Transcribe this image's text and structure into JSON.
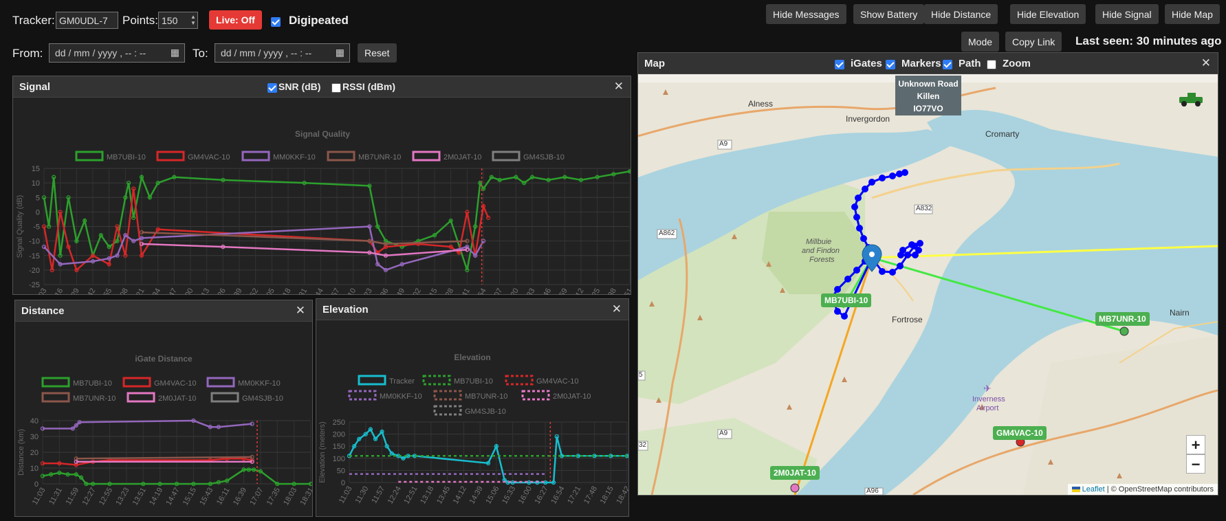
{
  "toolbar": {
    "tracker_label": "Tracker:",
    "tracker_value": "GM0UDL-7",
    "points_label": "Points:",
    "points_value": "150",
    "live_label": "Live: Off",
    "digipeated_label": "Digipeated",
    "from_label": "From:",
    "to_label": "To:",
    "date_placeholder": "dd / mm / yyyy ,  -- : --",
    "reset_label": "Reset",
    "buttons": [
      "Hide Messages",
      "Show Battery",
      "Hide Distance",
      "Hide Elevation",
      "Hide Signal",
      "Hide Map"
    ],
    "mode_label": "Mode",
    "copy_link_label": "Copy Link",
    "last_seen": "Last seen: 30 minutes ago"
  },
  "colors": {
    "MB7UBI-10": "#2ca02c",
    "GM4VAC-10": "#d62728",
    "MM0KKF-10": "#9467bd",
    "MB7UNR-10": "#8c564b",
    "2M0JAT-10": "#e377c2",
    "GM4SJB-10": "#7f7f7f",
    "Tracker": "#17becf"
  },
  "signal": {
    "title": "Signal",
    "snr_label": "SNR (dB)",
    "rssi_label": "RSSI (dBm)",
    "close": "✕",
    "chart_data": {
      "type": "line",
      "title": "Signal Quality",
      "ylabel": "Signal Quality (dB)",
      "ylim": [
        -25,
        15
      ],
      "yticks": [
        "15",
        "10",
        "5",
        "0",
        "-5",
        "-10",
        "-15",
        "-20",
        "-25"
      ],
      "xticks": [
        "11:03",
        "11:16",
        "11:29",
        "11:42",
        "11:55",
        "12:08",
        "12:21",
        "12:34",
        "12:47",
        "13:00",
        "13:13",
        "13:26",
        "13:39",
        "13:52",
        "14:05",
        "14:18",
        "14:31",
        "14:44",
        "14:57",
        "15:10",
        "15:23",
        "15:36",
        "15:49",
        "16:02",
        "16:15",
        "16:28",
        "16:41",
        "16:54",
        "17:07",
        "17:20",
        "17:33",
        "17:46",
        "17:59",
        "18:12",
        "18:25",
        "18:38",
        "18:51"
      ],
      "legend": [
        "MB7UBI-10",
        "GM4VAC-10",
        "MM0KKF-10",
        "MB7UNR-10",
        "2M0JAT-10",
        "GM4SJB-10"
      ],
      "series": [
        {
          "name": "MB7UBI-10",
          "x": [
            0,
            0.3,
            0.6,
            1,
            1.5,
            2,
            2.5,
            3,
            3.5,
            4,
            4.5,
            5,
            5.2,
            5.5,
            6,
            6.5,
            7,
            8,
            11,
            16,
            20,
            20.5,
            21,
            22,
            23,
            24,
            25,
            26,
            26.5,
            26.8,
            27,
            27.5,
            28,
            29,
            29.5,
            30,
            31,
            32,
            33,
            34,
            35,
            36,
            37
          ],
          "y": [
            5,
            -5,
            12,
            -15,
            5,
            -10,
            -3,
            -15,
            -8,
            -12,
            -10,
            5,
            10,
            -2,
            12,
            5,
            10,
            12,
            11,
            10,
            9,
            -5,
            -10,
            -12,
            -10,
            -8,
            -3,
            -20,
            -5,
            10,
            8,
            12,
            11,
            12,
            10,
            12,
            11,
            12,
            11,
            12,
            13,
            14,
            14
          ]
        },
        {
          "name": "GM4VAC-10",
          "x": [
            0,
            0.5,
            1,
            1.5,
            2,
            3,
            4,
            4.5,
            5,
            5.5,
            6,
            7,
            20,
            20.5,
            21,
            23,
            25,
            25.5,
            26,
            26.5,
            27,
            27.3
          ],
          "y": [
            -5,
            -20,
            0,
            -12,
            -20,
            -15,
            -18,
            -5,
            -15,
            8,
            -15,
            -6,
            -10,
            -14,
            -12,
            -11,
            -12,
            -14,
            0,
            -15,
            2,
            -2
          ]
        },
        {
          "name": "MM0KKF-10",
          "x": [
            0,
            1,
            3,
            4,
            4.5,
            5,
            5.5,
            6,
            20,
            20.5,
            21,
            22,
            26,
            26.5,
            27
          ],
          "y": [
            -12,
            -18,
            -17,
            -16,
            -15,
            -8,
            -10,
            -9,
            -5,
            -18,
            -20,
            -18,
            -12,
            -15,
            -10
          ]
        },
        {
          "name": "MB7UNR-10",
          "x": [
            6,
            20,
            21,
            26
          ],
          "y": [
            -7,
            -10,
            -11,
            -10
          ]
        },
        {
          "name": "2M0JAT-10",
          "x": [
            6,
            11,
            20,
            21,
            26
          ],
          "y": [
            -11,
            -12,
            -14,
            -15,
            -13
          ]
        },
        {
          "name": "GM4SJB-10",
          "x": [],
          "y": []
        }
      ],
      "marker_x": 26.9
    }
  },
  "distance": {
    "title": "Distance",
    "close": "✕",
    "chart_data": {
      "type": "line",
      "title": "iGate Distance",
      "ylabel": "Distance (km)",
      "ylim": [
        0,
        40
      ],
      "yticks": [
        "40",
        "30",
        "20",
        "10",
        "0"
      ],
      "xticks": [
        "11:03",
        "11:31",
        "11:59",
        "12:27",
        "12:55",
        "13:23",
        "13:51",
        "14:19",
        "14:47",
        "15:15",
        "15:43",
        "16:11",
        "16:39",
        "17:07",
        "17:35",
        "18:03",
        "18:31"
      ],
      "legend": [
        "MB7UBI-10",
        "GM4VAC-10",
        "MM0KKF-10",
        "MB7UNR-10",
        "2M0JAT-10",
        "GM4SJB-10"
      ],
      "series": [
        {
          "name": "MB7UBI-10",
          "x": [
            0,
            0.5,
            1,
            1.5,
            2,
            2.3,
            2.6,
            3,
            4,
            6,
            7,
            8,
            9,
            10,
            10.5,
            11,
            12,
            12.3,
            12.6,
            13,
            14,
            15,
            16
          ],
          "y": [
            5,
            6,
            7,
            6,
            6,
            4,
            0,
            0,
            0,
            0,
            0,
            0,
            0,
            0,
            1,
            2,
            9,
            9,
            9,
            8,
            0,
            0,
            0
          ]
        },
        {
          "name": "GM4VAC-10",
          "x": [
            0,
            1,
            2,
            3,
            4,
            10,
            11,
            12,
            12.5
          ],
          "y": [
            13,
            13,
            12,
            14,
            15,
            15,
            16,
            16,
            15
          ]
        },
        {
          "name": "MM0KKF-10",
          "x": [
            0,
            1.8,
            2,
            2.2,
            9,
            10,
            10.5,
            12.5
          ],
          "y": [
            35,
            35,
            37,
            39,
            40,
            36,
            36,
            38
          ]
        },
        {
          "name": "MB7UNR-10",
          "x": [
            2,
            12.5
          ],
          "y": [
            16,
            17
          ]
        },
        {
          "name": "2M0JAT-10",
          "x": [
            2,
            12.5
          ],
          "y": [
            14,
            14
          ]
        },
        {
          "name": "GM4SJB-10",
          "x": [],
          "y": []
        }
      ],
      "marker_x": 12.8
    }
  },
  "elevation": {
    "title": "Elevation",
    "close": "✕",
    "chart_data": {
      "type": "line",
      "title": "Elevation",
      "ylabel": "Elevation (meters)",
      "ylim": [
        0,
        250
      ],
      "yticks": [
        "250",
        "200",
        "150",
        "100",
        "50",
        "0"
      ],
      "xticks": [
        "11:03",
        "11:30",
        "11:57",
        "12:24",
        "12:51",
        "13:18",
        "13:45",
        "14:12",
        "14:39",
        "15:06",
        "15:33",
        "16:00",
        "16:27",
        "16:54",
        "17:21",
        "17:48",
        "18:15",
        "18:42"
      ],
      "legend": [
        "Tracker",
        "MB7UBI-10",
        "GM4VAC-10",
        "MM0KKF-10",
        "MB7UNR-10",
        "2M0JAT-10",
        "GM4SJB-10"
      ],
      "series": [
        {
          "name": "Tracker",
          "x": [
            0,
            0.3,
            0.6,
            1,
            1.3,
            1.6,
            2,
            2.3,
            2.6,
            3,
            3.3,
            3.6,
            4,
            8.5,
            9,
            9.5,
            9.7,
            10,
            11,
            11.5,
            12,
            12.5,
            12.7,
            13,
            14,
            15,
            16,
            17,
            18
          ],
          "y": [
            110,
            150,
            180,
            200,
            220,
            180,
            210,
            150,
            120,
            110,
            100,
            110,
            110,
            80,
            150,
            10,
            0,
            0,
            0,
            0,
            0,
            0,
            190,
            110,
            110,
            110,
            110,
            110,
            110
          ]
        },
        {
          "name": "MB7UBI-10",
          "x": [
            0,
            18
          ],
          "y": [
            110,
            110
          ]
        },
        {
          "name": "MM0KKF-10",
          "x": [
            0,
            12
          ],
          "y": [
            35,
            35
          ]
        },
        {
          "name": "2M0JAT-10",
          "x": [
            3,
            12
          ],
          "y": [
            3,
            3
          ]
        }
      ],
      "marker_x": 12.3
    }
  },
  "map": {
    "title": "Map",
    "close": "✕",
    "igates_label": "iGates",
    "markers_label": "Markers",
    "path_label": "Path",
    "zoom_label": "Zoom",
    "popup": [
      "Unknown Road",
      "Killen",
      "IO77VO"
    ],
    "places": [
      "Alness",
      "Invergordon",
      "Cromarty",
      "Millbuie",
      "and Findon",
      "Forests",
      "Fortrose",
      "Nairn",
      "Inverness",
      "Airport"
    ],
    "roads": [
      "A9",
      "A832",
      "A862",
      "A9",
      "A96",
      "5",
      "32"
    ],
    "station_labels": [
      "MB7UBI-10",
      "MB7UNR-10",
      "GM4VAC-10",
      "2M0JAT-10"
    ],
    "zoom_in": "+",
    "zoom_out": "−",
    "attribution_leaflet": "Leaflet",
    "attribution_rest": "| © OpenStreetMap contributors"
  }
}
